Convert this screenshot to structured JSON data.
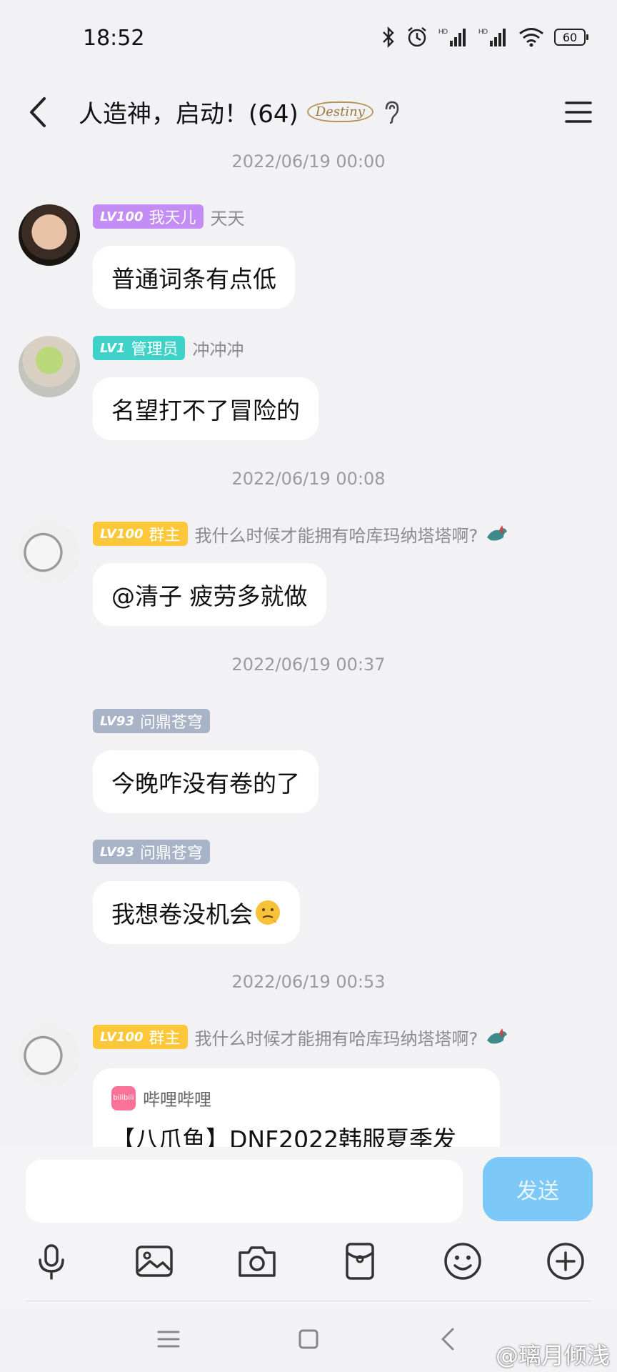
{
  "status_bar": {
    "time": "18:52",
    "battery": "60"
  },
  "header": {
    "title": "人造神，启动！(64)",
    "badge_text": "Destiny"
  },
  "messages": {
    "ts1": "2022/06/19 00:00",
    "m1": {
      "level": "LV100",
      "title": "我天儿",
      "name": "天天",
      "text": "普通词条有点低",
      "badge_color": "#c48cf5"
    },
    "m2": {
      "level": "LV1",
      "title": "管理员",
      "name": "冲冲冲",
      "text": "名望打不了冒险的",
      "badge_color": "#3ed2c8"
    },
    "ts2": "2022/06/19 00:08",
    "m3": {
      "level": "LV100",
      "title": "群主",
      "name": "我什么时候才能拥有哈库玛纳塔塔啊?",
      "text": "@清子  疲劳多就做",
      "badge_color": "#fcc83a"
    },
    "ts3": "2022/06/19 00:37",
    "m4": {
      "level": "LV93",
      "title": "问鼎苍穹",
      "text": "今晚咋没有卷的了",
      "badge_color": "#a9b3c8"
    },
    "m5": {
      "level": "LV93",
      "title": "问鼎苍穹",
      "text": "我想卷没机会",
      "badge_color": "#a9b3c8"
    },
    "ts4": "2022/06/19 00:53",
    "m6": {
      "level": "LV100",
      "title": "群主",
      "name": "我什么时候才能拥有哈库玛纳塔塔啊?",
      "badge_color": "#fcc83a"
    },
    "card": {
      "source": "哔哩哔哩",
      "title": "【八爪鱼】DNF2022韩服夏季发",
      "logo_text": "bilibili"
    }
  },
  "input": {
    "placeholder": "",
    "send_label": "发送"
  },
  "watermark": "@璃月倾浅",
  "icons": [
    "bluetooth-icon",
    "alarm-icon",
    "signal-icon",
    "wifi-icon",
    "mic-icon",
    "image-icon",
    "camera-icon",
    "red-packet-icon",
    "emoji-icon",
    "plus-icon"
  ]
}
